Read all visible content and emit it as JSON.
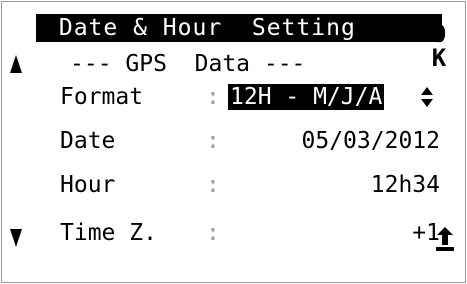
{
  "screen": {
    "title": " Date & Hour  Setting",
    "subtitle": "--- GPS  Data ---",
    "ok_label_top": "O",
    "ok_label_bottom": "K"
  },
  "rows": [
    {
      "label": "Format",
      "separator": ":",
      "value": "12H - M/J/A"
    },
    {
      "label": "Date",
      "separator": ":",
      "value": "05/03/2012"
    },
    {
      "label": "Hour",
      "separator": ":",
      "value": "12h34"
    },
    {
      "label": "Time Z.",
      "separator": ":",
      "value": "+1"
    }
  ],
  "icons": {
    "scroll_up": "up-arrow-icon",
    "scroll_down": "down-arrow-icon",
    "back": "return-icon",
    "spinner": "up-down-spinner-icon"
  },
  "colors": {
    "foreground": "#000000",
    "background": "#ffffff",
    "separator": "#9a9a9a"
  }
}
